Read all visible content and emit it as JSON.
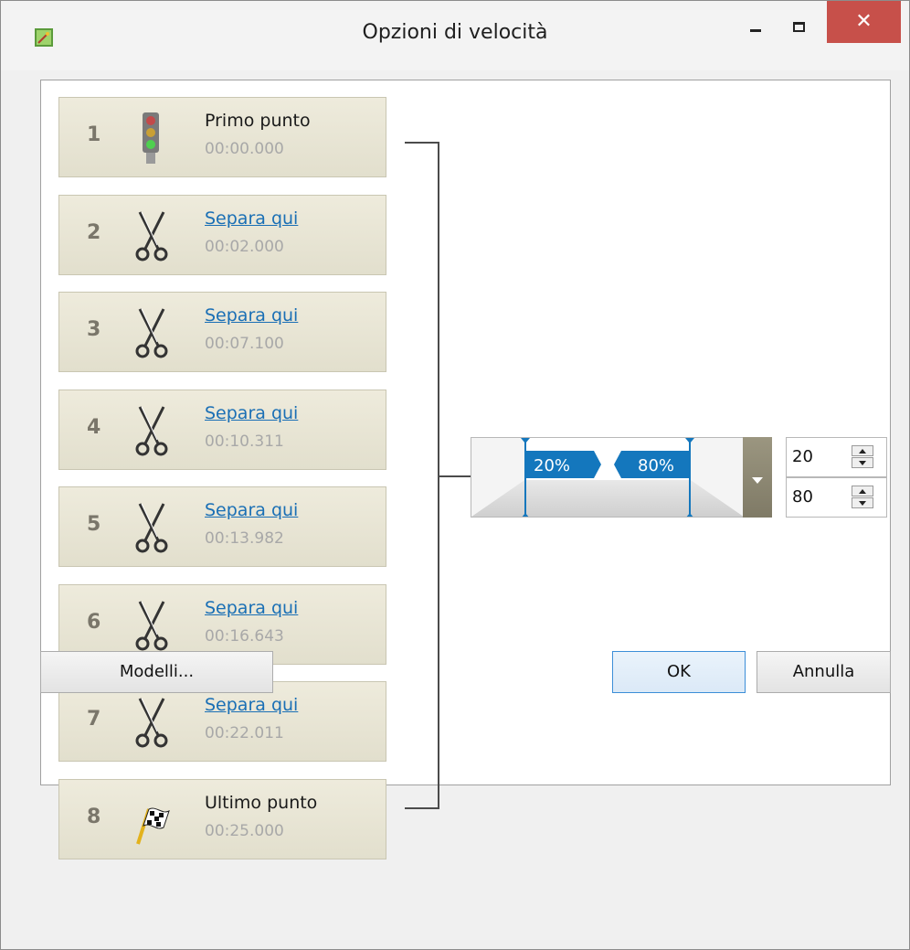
{
  "window": {
    "title": "Opzioni di velocità",
    "close_glyph": "✕"
  },
  "cards": [
    {
      "num": "1",
      "label": "Primo punto",
      "time": "00:00.000",
      "icon": "traffic-light-icon",
      "link": false
    },
    {
      "num": "2",
      "label": "Separa qui",
      "time": "00:02.000",
      "icon": "scissors-icon",
      "link": true
    },
    {
      "num": "3",
      "label": "Separa qui",
      "time": "00:07.100",
      "icon": "scissors-icon",
      "link": true
    },
    {
      "num": "4",
      "label": "Separa qui",
      "time": "00:10.311",
      "icon": "scissors-icon",
      "link": true
    },
    {
      "num": "5",
      "label": "Separa qui",
      "time": "00:13.982",
      "icon": "scissors-icon",
      "link": true
    },
    {
      "num": "6",
      "label": "Separa qui",
      "time": "00:16.643",
      "icon": "scissors-icon",
      "link": true
    },
    {
      "num": "7",
      "label": "Separa qui",
      "time": "00:22.011",
      "icon": "scissors-icon",
      "link": true
    },
    {
      "num": "8",
      "label": "Ultimo punto",
      "time": "00:25.000",
      "icon": "checkered-flag-icon",
      "link": false
    }
  ],
  "curve": {
    "left_label": "20%",
    "right_label": "80%",
    "accent": "#1477bd"
  },
  "spinners": {
    "start": "20",
    "end": "80"
  },
  "buttons": {
    "templates": "Modelli...",
    "ok": "OK",
    "cancel": "Annulla"
  }
}
